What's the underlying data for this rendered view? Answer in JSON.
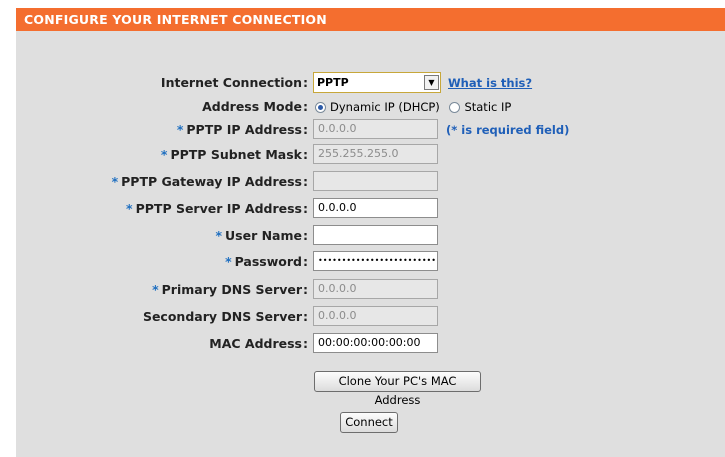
{
  "header": {
    "title": "CONFIGURE YOUR INTERNET CONNECTION"
  },
  "internet_connection": {
    "label": "Internet Connection",
    "value": "PPTP",
    "help_link": "What is this?"
  },
  "address_mode": {
    "label": "Address Mode",
    "options": [
      {
        "label": "Dynamic IP (DHCP)",
        "checked": true
      },
      {
        "label": "Static IP",
        "checked": false
      }
    ]
  },
  "fields": {
    "pptp_ip": {
      "label": "PPTP IP Address",
      "value": "0.0.0.0",
      "required": true
    },
    "required_note": "(* is required field)",
    "pptp_subnet": {
      "label": "PPTP Subnet Mask",
      "value": "255.255.255.0",
      "required": true
    },
    "pptp_gateway": {
      "label": "PPTP Gateway IP Address",
      "value": "",
      "required": true
    },
    "pptp_server": {
      "label": "PPTP Server IP Address",
      "value": "0.0.0.0",
      "required": true
    },
    "user_name": {
      "label": "User Name",
      "value": "",
      "required": true
    },
    "password": {
      "label": "Password",
      "value": "••••••••••••••••••••••••••••••",
      "required": true
    },
    "primary_dns": {
      "label": "Primary DNS Server",
      "value": "0.0.0.0",
      "required": true
    },
    "secondary_dns": {
      "label": "Secondary DNS Server",
      "value": "0.0.0.0",
      "required": false
    },
    "mac_address": {
      "label": "MAC Address",
      "value": "00:00:00:00:00:00",
      "required": false
    }
  },
  "buttons": {
    "clone_mac": "Clone Your PC's MAC Address",
    "connect": "Connect"
  },
  "colors": {
    "header": "#f46e2f",
    "panel": "#dfdfdf",
    "link": "#1f5fb8",
    "required_marker": "#1f6fc0"
  }
}
